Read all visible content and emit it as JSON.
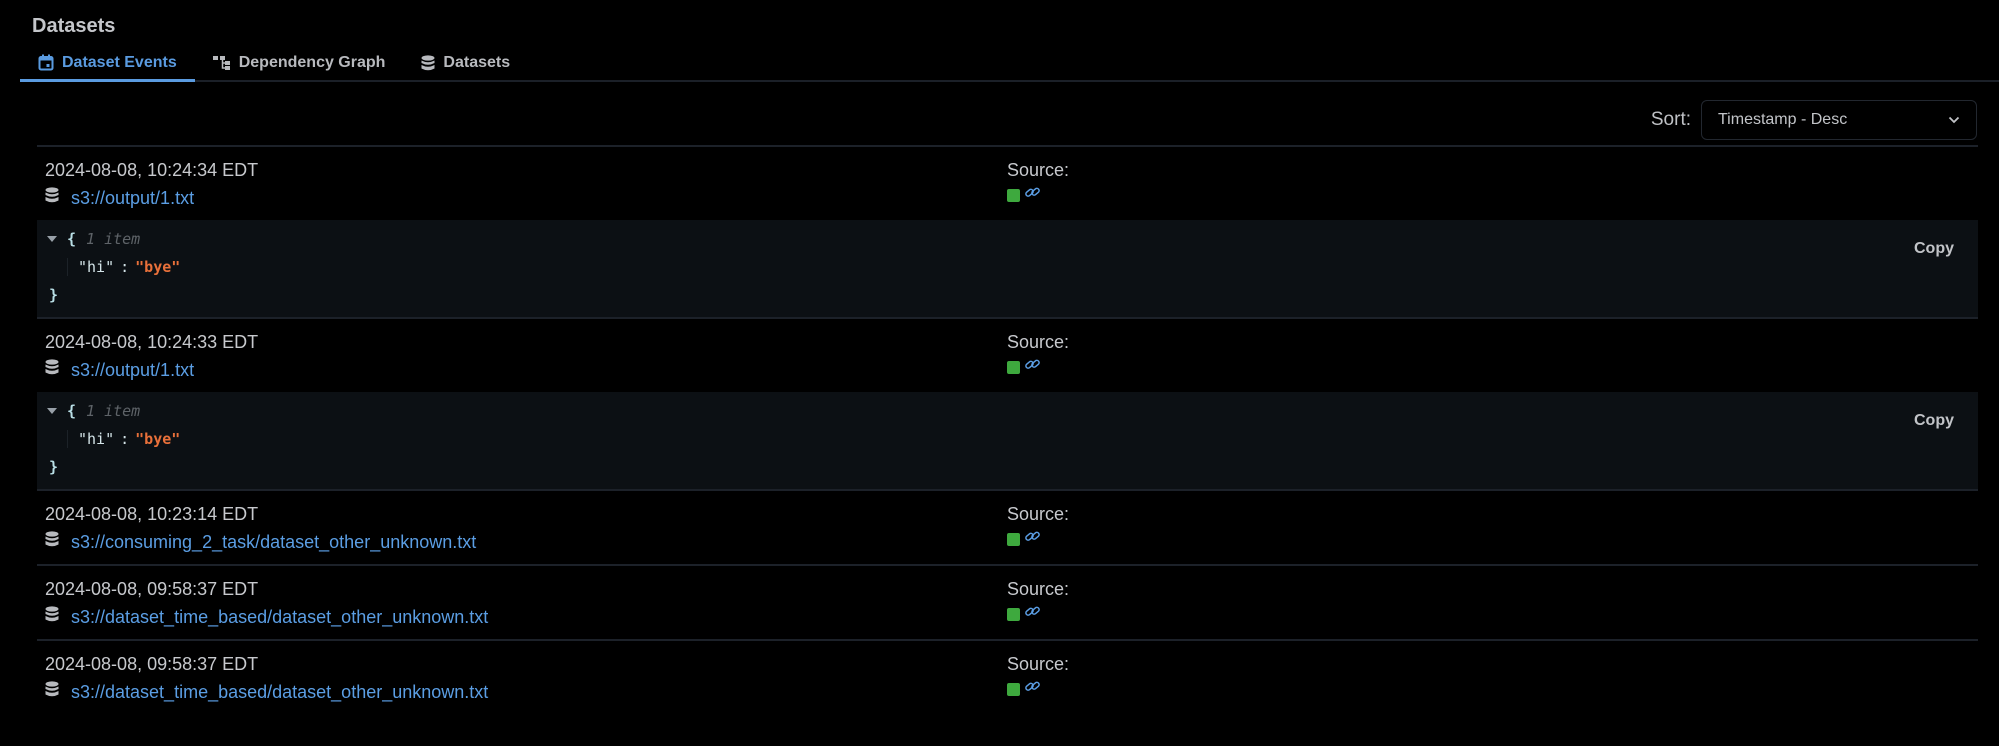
{
  "page": {
    "title": "Datasets"
  },
  "tabs": [
    {
      "label": "Dataset Events",
      "icon": "calendar-icon",
      "active": true
    },
    {
      "label": "Dependency Graph",
      "icon": "graph-icon",
      "active": false
    },
    {
      "label": "Datasets",
      "icon": "database-icon",
      "active": false
    }
  ],
  "sort": {
    "label": "Sort:",
    "selected": "Timestamp - Desc"
  },
  "colors": {
    "accent": "#5a9be0",
    "link": "#5b9ee4",
    "success": "#3ea93e",
    "json_string": "#e8703a"
  },
  "source_label": "Source:",
  "copy_label": "Copy",
  "events": [
    {
      "timestamp": "2024-08-08, 10:24:34 EDT",
      "uri": "s3://output/1.txt",
      "extra": {
        "open_brace": "{",
        "meta": "1 item",
        "key": "\"hi\"",
        "colon": ":",
        "value": "\"bye\"",
        "close_brace": "}"
      }
    },
    {
      "timestamp": "2024-08-08, 10:24:33 EDT",
      "uri": "s3://output/1.txt",
      "extra": {
        "open_brace": "{",
        "meta": "1 item",
        "key": "\"hi\"",
        "colon": ":",
        "value": "\"bye\"",
        "close_brace": "}"
      }
    },
    {
      "timestamp": "2024-08-08, 10:23:14 EDT",
      "uri": "s3://consuming_2_task/dataset_other_unknown.txt"
    },
    {
      "timestamp": "2024-08-08, 09:58:37 EDT",
      "uri": "s3://dataset_time_based/dataset_other_unknown.txt"
    },
    {
      "timestamp": "2024-08-08, 09:58:37 EDT",
      "uri": "s3://dataset_time_based/dataset_other_unknown.txt"
    }
  ]
}
